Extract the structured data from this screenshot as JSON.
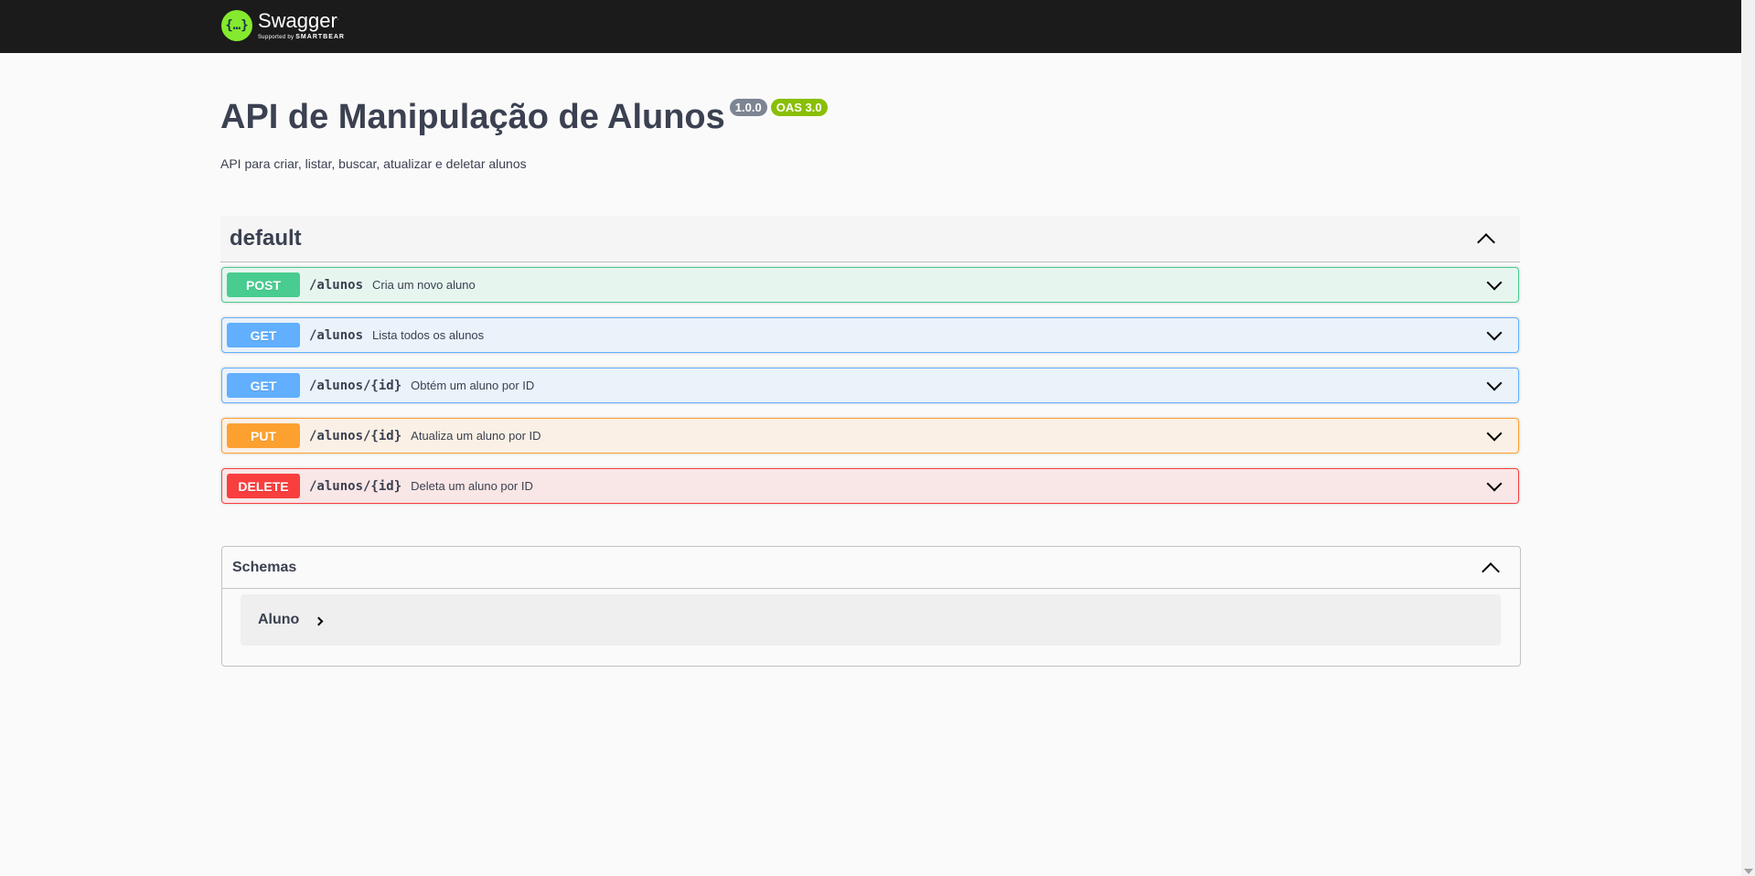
{
  "topbar": {
    "logo_text": "Swagger",
    "logo_sub_prefix": "Supported by",
    "logo_sub_brand": "SMARTBEAR"
  },
  "info": {
    "title": "API de Manipulação de Alunos",
    "version": "1.0.0",
    "oas": "OAS 3.0",
    "description": "API para criar, listar, buscar, atualizar e deletar alunos"
  },
  "tag": {
    "name": "default"
  },
  "operations": [
    {
      "method": "POST",
      "path": "/alunos",
      "summary": "Cria um novo aluno"
    },
    {
      "method": "GET",
      "path": "/alunos",
      "summary": "Lista todos os alunos"
    },
    {
      "method": "GET",
      "path": "/alunos/{id}",
      "summary": "Obtém um aluno por ID"
    },
    {
      "method": "PUT",
      "path": "/alunos/{id}",
      "summary": "Atualiza um aluno por ID"
    },
    {
      "method": "DELETE",
      "path": "/alunos/{id}",
      "summary": "Deleta um aluno por ID"
    }
  ],
  "schemas": {
    "title": "Schemas",
    "models": [
      {
        "name": "Aluno"
      }
    ]
  },
  "colors": {
    "post": "#49cc90",
    "get": "#61affe",
    "put": "#fca130",
    "delete": "#f93e3e",
    "topbar": "#1b1b1b",
    "logo": "#85ea2d"
  },
  "icons": {
    "logo": "swagger-logo-icon",
    "collapse": "chevron-up-icon",
    "expand": "chevron-down-icon",
    "model_expand": "chevron-right-icon"
  }
}
